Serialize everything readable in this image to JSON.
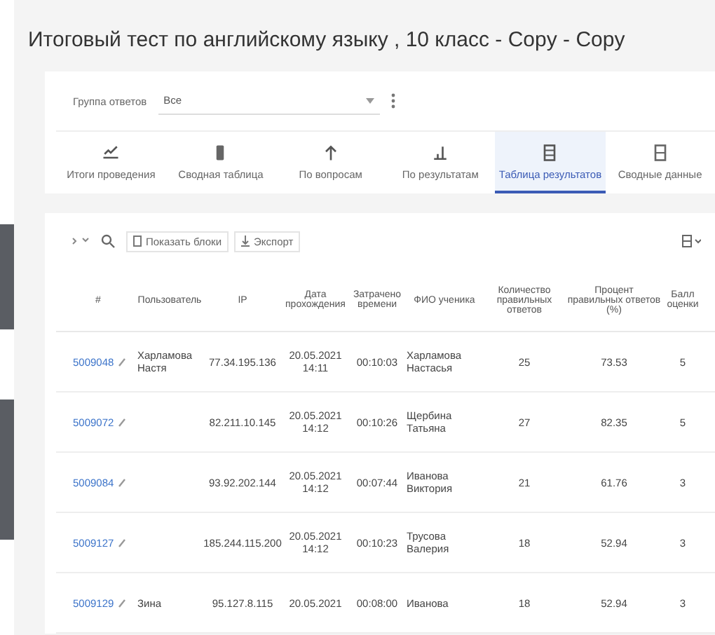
{
  "title": "Итоговый тест по английскому языку , 10 класс - Copy - Copy",
  "filter": {
    "label": "Группа ответов",
    "value": "Все"
  },
  "tabs": [
    {
      "label": "Итоги проведения",
      "selected": false
    },
    {
      "label": "Сводная таблица",
      "selected": false
    },
    {
      "label": "По вопросам",
      "selected": false
    },
    {
      "label": "По результатам",
      "selected": false
    },
    {
      "label": "Таблица результатов",
      "selected": true
    },
    {
      "label": "Сводные данные",
      "selected": false
    }
  ],
  "toolbar": {
    "buttons": [
      "Показать блоки",
      "Экспорт"
    ]
  },
  "table": {
    "columns": [
      "#",
      "Пользователь",
      "IP",
      "Дата прохождения",
      "Затрачено времени",
      "ФИО ученика",
      "Количество правильных ответов",
      "Процент правильных ответов (%)",
      "Балл оценки"
    ],
    "rows": [
      {
        "id": "5009048",
        "user": "Харламова Настя",
        "ip": "77.34.195.136",
        "date": "20.05.2021 14:11",
        "time": "00:10:03",
        "name": "Харламова Настасья",
        "correct": "25",
        "percent": "73.53",
        "grade": "5"
      },
      {
        "id": "5009072",
        "user": "",
        "ip": "82.211.10.145",
        "date": "20.05.2021 14:12",
        "time": "00:10:26",
        "name": "Щербина Татьяна",
        "correct": "27",
        "percent": "82.35",
        "grade": "5"
      },
      {
        "id": "5009084",
        "user": "",
        "ip": "93.92.202.144",
        "date": "20.05.2021 14:12",
        "time": "00:07:44",
        "name": "Иванова Виктория",
        "correct": "21",
        "percent": "61.76",
        "grade": "3"
      },
      {
        "id": "5009127",
        "user": "",
        "ip": "185.244.115.200",
        "date": "20.05.2021 14:12",
        "time": "00:10:23",
        "name": "Трусова Валерия",
        "correct": "18",
        "percent": "52.94",
        "grade": "3"
      },
      {
        "id": "5009129",
        "user": "Зина",
        "ip": "95.127.8.115",
        "date": "20.05.2021",
        "time": "00:08:00",
        "name": "Иванова",
        "correct": "18",
        "percent": "52.94",
        "grade": "3"
      }
    ]
  }
}
